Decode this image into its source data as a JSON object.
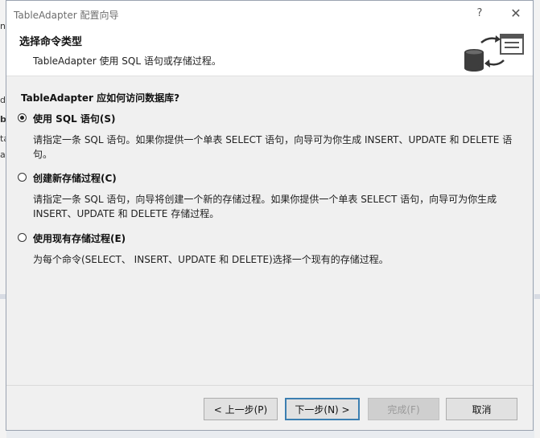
{
  "window": {
    "title": "TableAdapter 配置向导",
    "help_glyph": "?",
    "close_glyph": "✕"
  },
  "header": {
    "title": "选择命令类型",
    "subtitle": "TableAdapter 使用 SQL 语句或存储过程。"
  },
  "question": "TableAdapter 应如何访问数据库?",
  "options": [
    {
      "label": "使用 SQL 语句(S)",
      "checked": true,
      "desc": "请指定一条 SQL 语句。如果你提供一个单表 SELECT 语句，向导可为你生成 INSERT、UPDATE 和 DELETE 语句。"
    },
    {
      "label": "创建新存储过程(C)",
      "checked": false,
      "desc": "请指定一条 SQL 语句，向导将创建一个新的存储过程。如果你提供一个单表 SELECT 语句，向导可为你生成 INSERT、UPDATE 和 DELETE 存储过程。"
    },
    {
      "label": "使用现有存储过程(E)",
      "checked": false,
      "desc": "为每个命令(SELECT、 INSERT、UPDATE 和 DELETE)选择一个现有的存储过程。"
    }
  ],
  "buttons": {
    "previous": "< 上一步(P)",
    "next": "下一步(N) >",
    "finish": "完成(F)",
    "cancel": "取消"
  },
  "background": {
    "left_fragments": [
      "n",
      "d",
      "b",
      "ta",
      "as"
    ]
  }
}
